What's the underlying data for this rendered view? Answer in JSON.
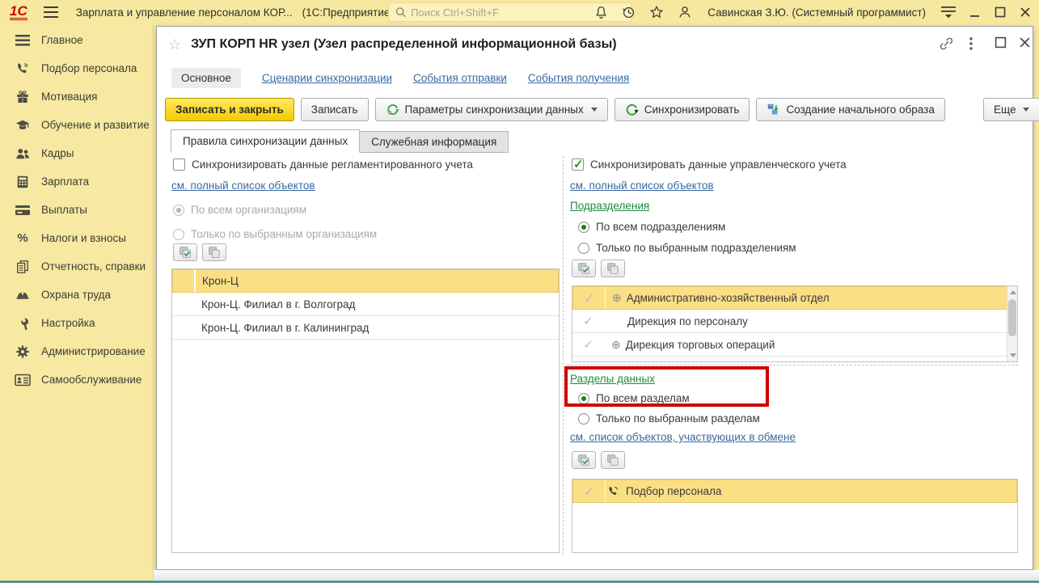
{
  "colors": {
    "brand_red": "#cc0000",
    "bar_yellow": "#f7e8a0",
    "highlight_yellow": "#fbdf85",
    "primary_button_yellow": "#f5ca00",
    "link_blue": "#38699f",
    "link_green": "#1f8a41",
    "annotation_red": "#cc0000"
  },
  "top_bar": {
    "logo": "1С",
    "app_title": "Зарплата и управление персоналом КОР...",
    "app_subtitle": "(1С:Предприятие)",
    "search_placeholder": "Поиск Ctrl+Shift+F",
    "user": "Савинская З.Ю. (Системный программист)"
  },
  "sidebar": {
    "items": [
      {
        "label": "Главное",
        "icon": "menu-icon"
      },
      {
        "label": "Подбор персонала",
        "icon": "phone-icon"
      },
      {
        "label": "Мотивация",
        "icon": "gift-icon"
      },
      {
        "label": "Обучение и развитие",
        "icon": "graduation-icon"
      },
      {
        "label": "Кадры",
        "icon": "people-icon"
      },
      {
        "label": "Зарплата",
        "icon": "calculator-icon"
      },
      {
        "label": "Выплаты",
        "icon": "card-icon"
      },
      {
        "label": "Налоги и взносы",
        "icon": "percent-icon"
      },
      {
        "label": "Отчетность, справки",
        "icon": "report-icon"
      },
      {
        "label": "Охрана труда",
        "icon": "helmet-icon"
      },
      {
        "label": "Настройка",
        "icon": "wrench-icon"
      },
      {
        "label": "Администрирование",
        "icon": "gear-icon"
      },
      {
        "label": "Самообслуживание",
        "icon": "badge-icon"
      }
    ]
  },
  "window": {
    "title": "ЗУП КОРП HR узел (Узел распределенной информационной базы)",
    "nav_tabs": [
      {
        "label": "Основное"
      },
      {
        "label": "Сценарии синхронизации"
      },
      {
        "label": "События отправки"
      },
      {
        "label": "События получения"
      }
    ],
    "toolbar": {
      "save_close": "Записать и закрыть",
      "save": "Записать",
      "sync_params": "Параметры синхронизации данных",
      "synchronize": "Синхронизировать",
      "initial_image": "Создание начального образа",
      "more": "Еще"
    },
    "page_tabs": [
      {
        "label": "Правила синхронизации данных"
      },
      {
        "label": "Служебная информация"
      }
    ]
  },
  "left_panel": {
    "checkbox_label": "Синхронизировать данные регламентированного учета",
    "full_list_link": "см. полный список объектов",
    "radio_all": "По всем организациям",
    "radio_selected": "Только по выбранным организациям",
    "organizations": [
      "Крон-Ц",
      "Крон-Ц. Филиал в г. Волгоград",
      "Крон-Ц. Филиал в г. Калининград"
    ]
  },
  "right_panel": {
    "checkbox_label": "Синхронизировать данные управленческого учета",
    "full_list_link": "см. полный список объектов",
    "departments_link": "Подразделения",
    "radio_all_departments": "По всем подразделениям",
    "radio_selected_departments": "Только по выбранным подразделениям",
    "departments": [
      {
        "name": "Административно-хозяйственный отдел"
      },
      {
        "name": "Дирекция по персоналу"
      },
      {
        "name": "Дирекция торговых операций"
      }
    ],
    "sections_link": "Разделы данных",
    "radio_all_sections": "По всем разделам",
    "radio_selected_sections": "Только по выбранным разделам",
    "exchange_objects_link": "см. список объектов, участвующих в обмене",
    "sections": [
      {
        "name": "Подбор персонала"
      }
    ]
  }
}
